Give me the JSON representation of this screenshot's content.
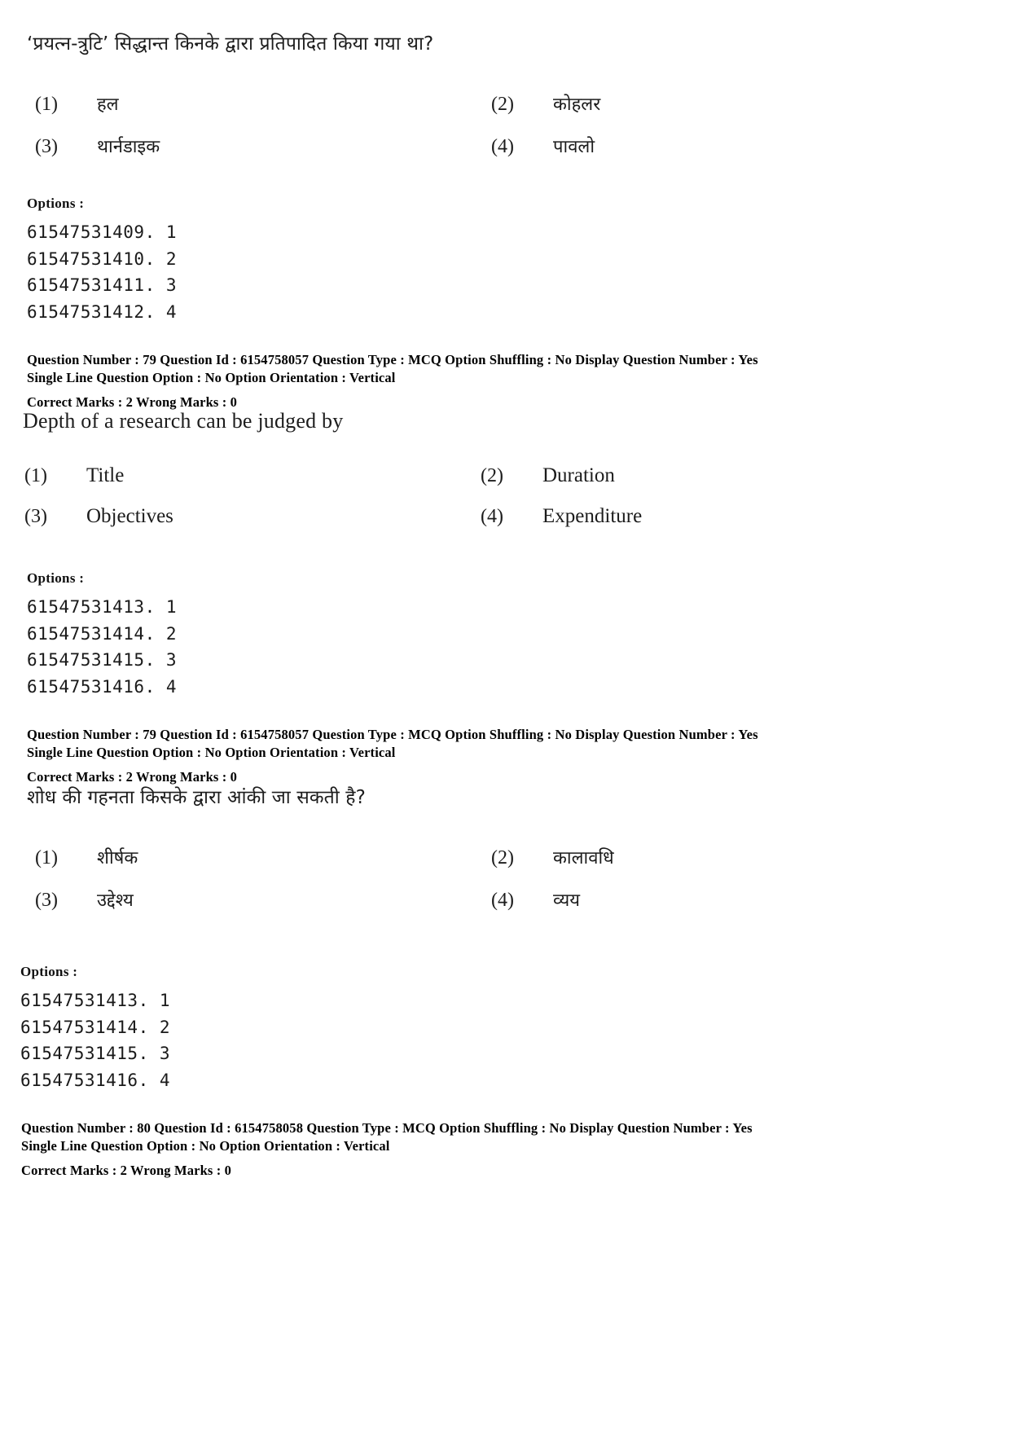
{
  "document": {
    "type": "exam-question-paper",
    "language": "Hindi/English bilingual"
  },
  "labels": {
    "options_heading": "Options :"
  },
  "blocks": [
    {
      "id": "q79-hindi",
      "stem": "‘प्रयत्न-त्रुटि’ सिद्धान्त किनके द्वारा प्रतिपादित किया गया था?",
      "script": "devanagari",
      "choices": [
        {
          "num": "(1)",
          "text": "हल"
        },
        {
          "num": "(2)",
          "text": "कोहलर"
        },
        {
          "num": "(3)",
          "text": "थार्नडाइक"
        },
        {
          "num": "(4)",
          "text": "पावलो"
        }
      ],
      "option_ids": [
        "61547531409. 1",
        "61547531410. 2",
        "61547531411. 3",
        "61547531412. 4"
      ],
      "meta": {
        "line1": "Question Number : 79  Question Id : 6154758057  Question Type : MCQ  Option Shuffling : No  Display Question Number : Yes",
        "line2": "Single Line Question Option : No  Option Orientation : Vertical",
        "marks": "Correct Marks : 2  Wrong Marks : 0"
      }
    },
    {
      "id": "q79-english",
      "stem": "Depth of a research can be judged by",
      "script": "latin",
      "choices": [
        {
          "num": "(1)",
          "text": "Title"
        },
        {
          "num": "(2)",
          "text": "Duration"
        },
        {
          "num": "(3)",
          "text": "Objectives"
        },
        {
          "num": "(4)",
          "text": "Expenditure"
        }
      ],
      "option_ids": [
        "61547531413. 1",
        "61547531414. 2",
        "61547531415. 3",
        "61547531416. 4"
      ],
      "meta": {
        "line1": "Question Number : 79  Question Id : 6154758057  Question Type : MCQ  Option Shuffling : No  Display Question Number : Yes",
        "line2": "Single Line Question Option : No  Option Orientation : Vertical",
        "marks": "Correct Marks : 2  Wrong Marks : 0"
      }
    },
    {
      "id": "q80-hindi",
      "stem": "शोध की गहनता किसके द्वारा आंकी जा सकती है?",
      "script": "devanagari",
      "choices": [
        {
          "num": "(1)",
          "text": "शीर्षक"
        },
        {
          "num": "(2)",
          "text": "कालावधि"
        },
        {
          "num": "(3)",
          "text": "उद्देश्य"
        },
        {
          "num": "(4)",
          "text": "व्यय"
        }
      ],
      "option_ids": [
        "61547531413. 1",
        "61547531414. 2",
        "61547531415. 3",
        "61547531416. 4"
      ],
      "meta": {
        "line1": "Question Number : 80  Question Id : 6154758058  Question Type : MCQ  Option Shuffling : No  Display Question Number : Yes",
        "line2": "Single Line Question Option : No  Option Orientation : Vertical",
        "marks": "Correct Marks : 2  Wrong Marks : 0"
      }
    }
  ]
}
